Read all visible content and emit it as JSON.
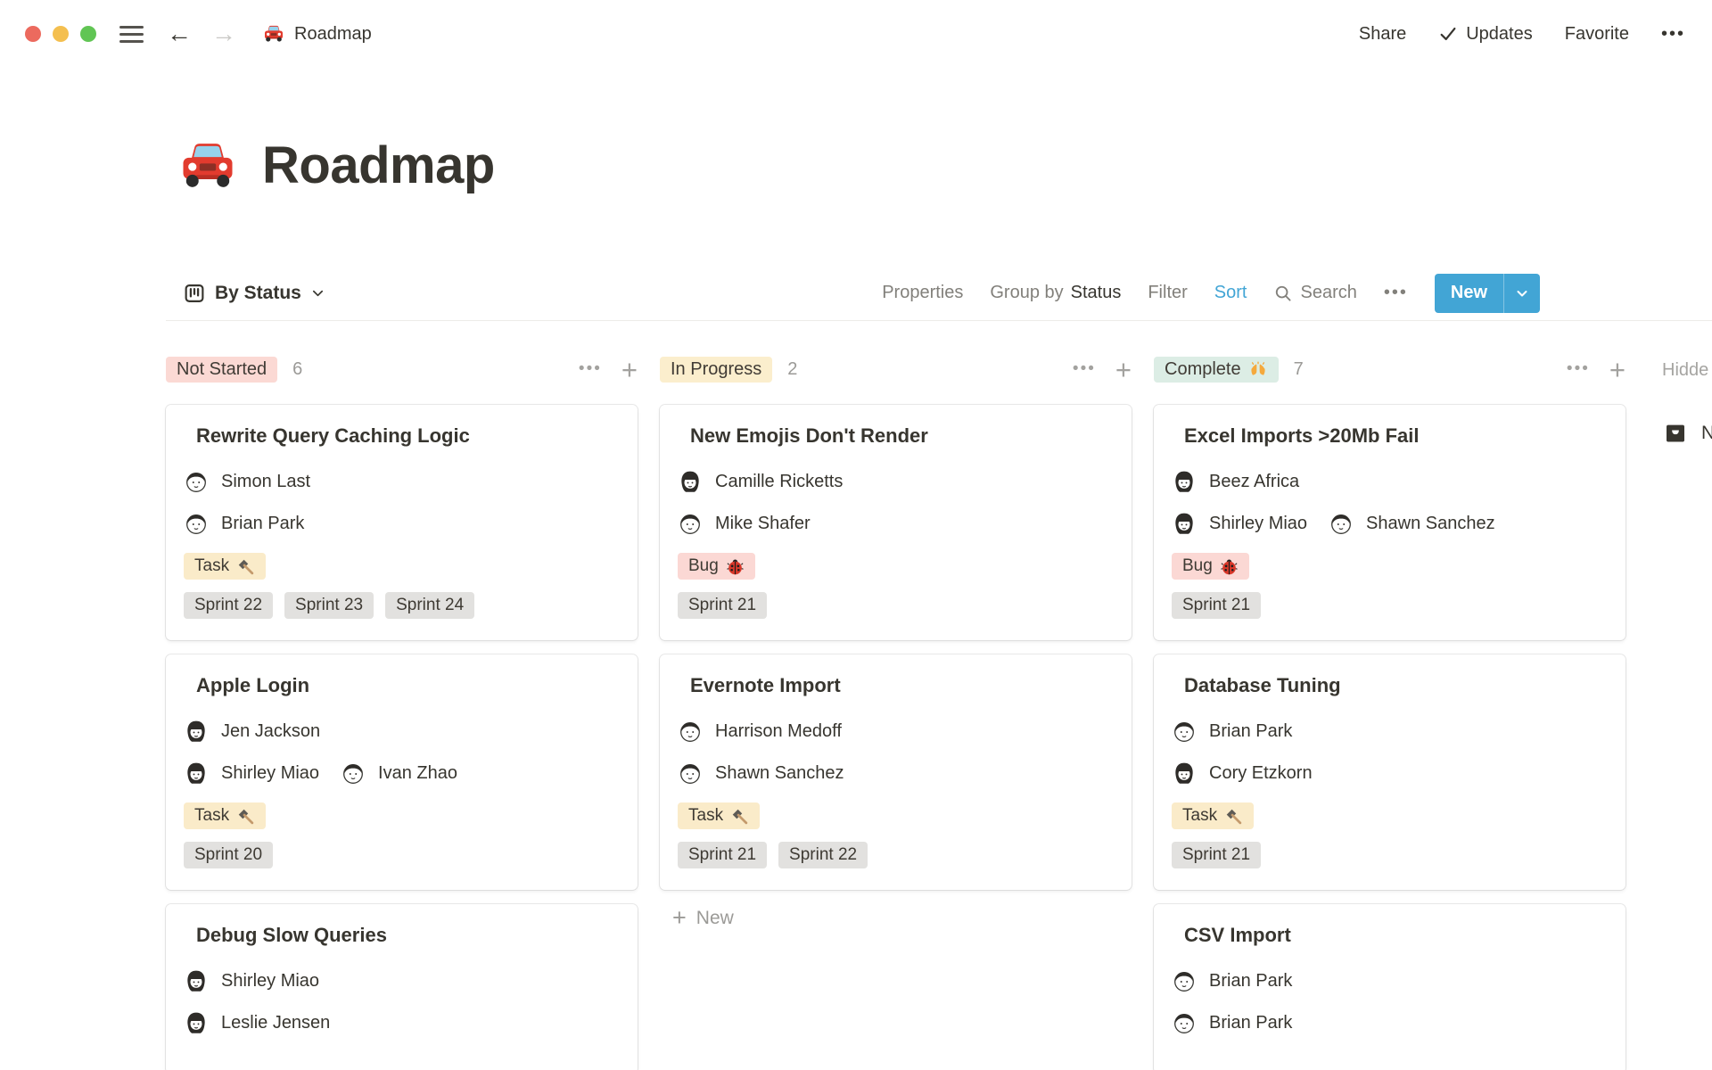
{
  "colors": {
    "accent_blue": "#42A5D5",
    "traffic_red": "#EC6A5E",
    "traffic_yellow": "#F4BF4F",
    "traffic_green": "#61C554",
    "sprint_chip_bg": "#E2E1DF"
  },
  "topbar": {
    "breadcrumb_icon": "car-icon",
    "breadcrumb": "Roadmap",
    "share": "Share",
    "updates": "Updates",
    "favorite": "Favorite",
    "more": "•••"
  },
  "page": {
    "icon": "car-icon",
    "title": "Roadmap"
  },
  "toolbar": {
    "view": "By Status",
    "properties": "Properties",
    "group_by_label": "Group by",
    "group_by_value": "Status",
    "filter": "Filter",
    "sort": "Sort",
    "search": "Search",
    "more": "•••",
    "new": "New"
  },
  "board": {
    "hidden_label": "Hidde",
    "no_status_label": "N",
    "columns": [
      {
        "name": "Not Started",
        "count": "6",
        "badge_bg": "#FBD9D4",
        "cards": [
          {
            "title": "Rewrite Query Caching Logic",
            "people": [
              [
                {
                  "name": "Simon Last",
                  "avatar": "man"
                }
              ],
              [
                {
                  "name": "Brian Park",
                  "avatar": "man"
                }
              ]
            ],
            "tags": [
              {
                "label": "Task",
                "icon": "hammer-icon",
                "bg": "#FAEBC9"
              }
            ],
            "sprints": [
              "Sprint 22",
              "Sprint 23",
              "Sprint 24"
            ]
          },
          {
            "title": "Apple Login",
            "people": [
              [
                {
                  "name": "Jen Jackson",
                  "avatar": "woman"
                }
              ],
              [
                {
                  "name": "Shirley Miao",
                  "avatar": "woman"
                },
                {
                  "name": "Ivan Zhao",
                  "avatar": "man"
                }
              ]
            ],
            "tags": [
              {
                "label": "Task",
                "icon": "hammer-icon",
                "bg": "#FAEBC9"
              }
            ],
            "sprints": [
              "Sprint 20"
            ]
          },
          {
            "title": "Debug Slow Queries",
            "people": [
              [
                {
                  "name": "Shirley Miao",
                  "avatar": "woman"
                }
              ],
              [
                {
                  "name": "Leslie Jensen",
                  "avatar": "woman"
                }
              ]
            ],
            "tags": [],
            "sprints": []
          }
        ]
      },
      {
        "name": "In Progress",
        "count": "2",
        "badge_bg": "#FBEECD",
        "new_label": "New",
        "cards": [
          {
            "title": "New Emojis Don't Render",
            "people": [
              [
                {
                  "name": "Camille Ricketts",
                  "avatar": "woman"
                }
              ],
              [
                {
                  "name": "Mike Shafer",
                  "avatar": "man"
                }
              ]
            ],
            "tags": [
              {
                "label": "Bug",
                "icon": "ladybug-icon",
                "bg": "#FBD8D4"
              }
            ],
            "sprints": [
              "Sprint 21"
            ]
          },
          {
            "title": "Evernote Import",
            "people": [
              [
                {
                  "name": "Harrison Medoff",
                  "avatar": "man"
                }
              ],
              [
                {
                  "name": "Shawn Sanchez",
                  "avatar": "man"
                }
              ]
            ],
            "tags": [
              {
                "label": "Task",
                "icon": "hammer-icon",
                "bg": "#FAEBC9"
              }
            ],
            "sprints": [
              "Sprint 21",
              "Sprint 22"
            ]
          }
        ]
      },
      {
        "name": "Complete",
        "name_icon": "raised-hands-icon",
        "count": "7",
        "badge_bg": "#DCEDE5",
        "cards": [
          {
            "title": "Excel Imports >20Mb Fail",
            "people": [
              [
                {
                  "name": "Beez Africa",
                  "avatar": "woman"
                }
              ],
              [
                {
                  "name": "Shirley Miao",
                  "avatar": "woman"
                },
                {
                  "name": "Shawn Sanchez",
                  "avatar": "man"
                }
              ]
            ],
            "tags": [
              {
                "label": "Bug",
                "icon": "ladybug-icon",
                "bg": "#FBD8D4"
              }
            ],
            "sprints": [
              "Sprint 21"
            ]
          },
          {
            "title": "Database Tuning",
            "people": [
              [
                {
                  "name": "Brian Park",
                  "avatar": "man"
                }
              ],
              [
                {
                  "name": "Cory Etzkorn",
                  "avatar": "woman"
                }
              ]
            ],
            "tags": [
              {
                "label": "Task",
                "icon": "hammer-icon",
                "bg": "#FAEBC9"
              }
            ],
            "sprints": [
              "Sprint 21"
            ]
          },
          {
            "title": "CSV Import",
            "people": [
              [
                {
                  "name": "Brian Park",
                  "avatar": "man"
                }
              ],
              [
                {
                  "name": "Brian Park",
                  "avatar": "man"
                }
              ]
            ],
            "tags": [],
            "sprints": []
          }
        ]
      }
    ]
  }
}
